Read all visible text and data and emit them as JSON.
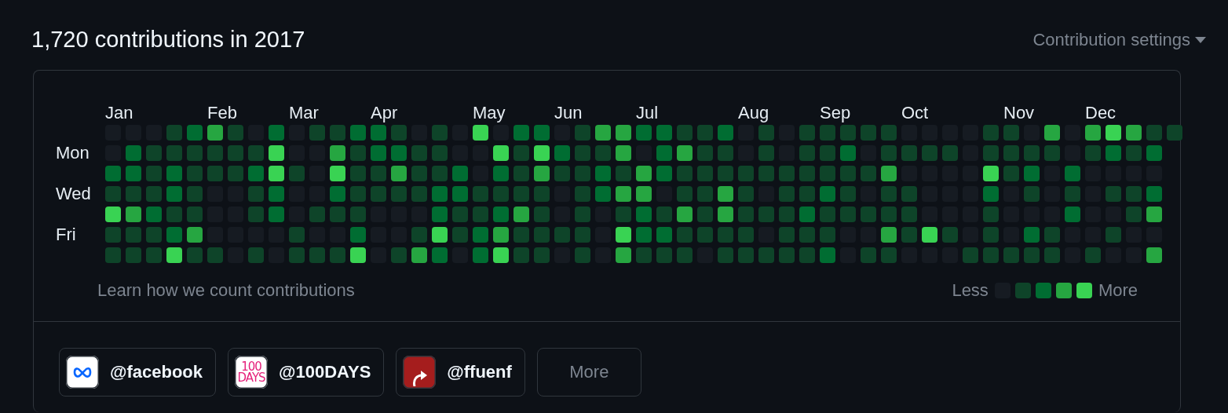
{
  "header": {
    "title": "1,720 contributions in 2017",
    "settings": "Contribution settings"
  },
  "graph": {
    "weekdays": [
      "Mon",
      "Wed",
      "Fri"
    ],
    "weeks": [
      {
        "month": "Jan",
        "days": [
          {
            "color": "#161b22"
          },
          {
            "color": "#161b22"
          },
          {
            "color": "#006d32"
          },
          {
            "color": "#0e4429"
          },
          {
            "color": "#39d353"
          },
          {
            "color": "#0e4429"
          },
          {
            "color": "#0e4429"
          }
        ]
      },
      {
        "days": [
          {
            "color": "#161b22"
          },
          {
            "color": "#006d32"
          },
          {
            "color": "#006d32"
          },
          {
            "color": "#0e4429"
          },
          {
            "color": "#26a641"
          },
          {
            "color": "#0e4429"
          },
          {
            "color": "#0e4429"
          }
        ]
      },
      {
        "days": [
          {
            "color": "#161b22"
          },
          {
            "color": "#0e4429"
          },
          {
            "color": "#0e4429"
          },
          {
            "color": "#0e4429"
          },
          {
            "color": "#006d32"
          },
          {
            "color": "#0e4429"
          },
          {
            "color": "#0e4429"
          }
        ]
      },
      {
        "days": [
          {
            "color": "#0e4429"
          },
          {
            "color": "#0e4429"
          },
          {
            "color": "#006d32"
          },
          {
            "color": "#006d32"
          },
          {
            "color": "#0e4429"
          },
          {
            "color": "#006d32"
          },
          {
            "color": "#39d353"
          }
        ]
      },
      {
        "days": [
          {
            "color": "#006d32"
          },
          {
            "color": "#0e4429"
          },
          {
            "color": "#0e4429"
          },
          {
            "color": "#0e4429"
          },
          {
            "color": "#0e4429"
          },
          {
            "color": "#26a641"
          },
          {
            "color": "#0e4429"
          }
        ]
      },
      {
        "month": "Feb",
        "days": [
          {
            "color": "#26a641"
          },
          {
            "color": "#0e4429"
          },
          {
            "color": "#0e4429"
          },
          {
            "color": "#161b22"
          },
          {
            "color": "#161b22"
          },
          {
            "color": "#161b22"
          },
          {
            "color": "#0e4429"
          }
        ]
      },
      {
        "days": [
          {
            "color": "#0e4429"
          },
          {
            "color": "#0e4429"
          },
          {
            "color": "#0e4429"
          },
          {
            "color": "#161b22"
          },
          {
            "color": "#161b22"
          },
          {
            "color": "#161b22"
          },
          {
            "color": "#161b22"
          }
        ]
      },
      {
        "days": [
          {
            "color": "#161b22"
          },
          {
            "color": "#0e4429"
          },
          {
            "color": "#006d32"
          },
          {
            "color": "#0e4429"
          },
          {
            "color": "#0e4429"
          },
          {
            "color": "#161b22"
          },
          {
            "color": "#0e4429"
          }
        ]
      },
      {
        "days": [
          {
            "color": "#006d32"
          },
          {
            "color": "#39d353"
          },
          {
            "color": "#39d353"
          },
          {
            "color": "#006d32"
          },
          {
            "color": "#006d32"
          },
          {
            "color": "#161b22"
          },
          {
            "color": "#161b22"
          }
        ]
      },
      {
        "month": "Mar",
        "days": [
          {
            "color": "#161b22"
          },
          {
            "color": "#161b22"
          },
          {
            "color": "#0e4429"
          },
          {
            "color": "#161b22"
          },
          {
            "color": "#161b22"
          },
          {
            "color": "#0e4429"
          },
          {
            "color": "#0e4429"
          }
        ]
      },
      {
        "days": [
          {
            "color": "#0e4429"
          },
          {
            "color": "#161b22"
          },
          {
            "color": "#161b22"
          },
          {
            "color": "#161b22"
          },
          {
            "color": "#0e4429"
          },
          {
            "color": "#161b22"
          },
          {
            "color": "#0e4429"
          }
        ]
      },
      {
        "days": [
          {
            "color": "#0e4429"
          },
          {
            "color": "#26a641"
          },
          {
            "color": "#39d353"
          },
          {
            "color": "#006d32"
          },
          {
            "color": "#0e4429"
          },
          {
            "color": "#161b22"
          },
          {
            "color": "#0e4429"
          }
        ]
      },
      {
        "days": [
          {
            "color": "#006d32"
          },
          {
            "color": "#0e4429"
          },
          {
            "color": "#0e4429"
          },
          {
            "color": "#0e4429"
          },
          {
            "color": "#0e4429"
          },
          {
            "color": "#006d32"
          },
          {
            "color": "#39d353"
          }
        ]
      },
      {
        "month": "Apr",
        "days": [
          {
            "color": "#006d32"
          },
          {
            "color": "#006d32"
          },
          {
            "color": "#0e4429"
          },
          {
            "color": "#0e4429"
          },
          {
            "color": "#161b22"
          },
          {
            "color": "#161b22"
          },
          {
            "color": "#161b22"
          }
        ]
      },
      {
        "days": [
          {
            "color": "#0e4429"
          },
          {
            "color": "#006d32"
          },
          {
            "color": "#26a641"
          },
          {
            "color": "#0e4429"
          },
          {
            "color": "#161b22"
          },
          {
            "color": "#161b22"
          },
          {
            "color": "#0e4429"
          }
        ]
      },
      {
        "days": [
          {
            "color": "#161b22"
          },
          {
            "color": "#0e4429"
          },
          {
            "color": "#0e4429"
          },
          {
            "color": "#0e4429"
          },
          {
            "color": "#161b22"
          },
          {
            "color": "#0e4429"
          },
          {
            "color": "#26a641"
          }
        ]
      },
      {
        "days": [
          {
            "color": "#0e4429"
          },
          {
            "color": "#0e4429"
          },
          {
            "color": "#0e4429"
          },
          {
            "color": "#006d32"
          },
          {
            "color": "#006d32"
          },
          {
            "color": "#39d353"
          },
          {
            "color": "#006d32"
          }
        ]
      },
      {
        "days": [
          {
            "color": "#161b22"
          },
          {
            "color": "#161b22"
          },
          {
            "color": "#006d32"
          },
          {
            "color": "#006d32"
          },
          {
            "color": "#0e4429"
          },
          {
            "color": "#0e4429"
          },
          {
            "color": "#161b22"
          }
        ]
      },
      {
        "month": "May",
        "days": [
          {
            "color": "#39d353"
          },
          {
            "color": "#161b22"
          },
          {
            "color": "#161b22"
          },
          {
            "color": "#0e4429"
          },
          {
            "color": "#0e4429"
          },
          {
            "color": "#006d32"
          },
          {
            "color": "#006d32"
          }
        ]
      },
      {
        "days": [
          {
            "color": "#161b22"
          },
          {
            "color": "#39d353"
          },
          {
            "color": "#006d32"
          },
          {
            "color": "#0e4429"
          },
          {
            "color": "#006d32"
          },
          {
            "color": "#26a641"
          },
          {
            "color": "#39d353"
          }
        ]
      },
      {
        "days": [
          {
            "color": "#006d32"
          },
          {
            "color": "#0e4429"
          },
          {
            "color": "#0e4429"
          },
          {
            "color": "#0e4429"
          },
          {
            "color": "#26a641"
          },
          {
            "color": "#0e4429"
          },
          {
            "color": "#0e4429"
          }
        ]
      },
      {
        "days": [
          {
            "color": "#006d32"
          },
          {
            "color": "#39d353"
          },
          {
            "color": "#26a641"
          },
          {
            "color": "#0e4429"
          },
          {
            "color": "#0e4429"
          },
          {
            "color": "#0e4429"
          },
          {
            "color": "#0e4429"
          }
        ]
      },
      {
        "month": "Jun",
        "days": [
          {
            "color": "#161b22"
          },
          {
            "color": "#006d32"
          },
          {
            "color": "#0e4429"
          },
          {
            "color": "#161b22"
          },
          {
            "color": "#161b22"
          },
          {
            "color": "#0e4429"
          },
          {
            "color": "#161b22"
          }
        ]
      },
      {
        "days": [
          {
            "color": "#0e4429"
          },
          {
            "color": "#0e4429"
          },
          {
            "color": "#0e4429"
          },
          {
            "color": "#0e4429"
          },
          {
            "color": "#0e4429"
          },
          {
            "color": "#0e4429"
          },
          {
            "color": "#0e4429"
          }
        ]
      },
      {
        "days": [
          {
            "color": "#26a641"
          },
          {
            "color": "#0e4429"
          },
          {
            "color": "#006d32"
          },
          {
            "color": "#006d32"
          },
          {
            "color": "#161b22"
          },
          {
            "color": "#161b22"
          },
          {
            "color": "#161b22"
          }
        ]
      },
      {
        "days": [
          {
            "color": "#26a641"
          },
          {
            "color": "#26a641"
          },
          {
            "color": "#0e4429"
          },
          {
            "color": "#26a641"
          },
          {
            "color": "#0e4429"
          },
          {
            "color": "#39d353"
          },
          {
            "color": "#26a641"
          }
        ]
      },
      {
        "month": "Jul",
        "days": [
          {
            "color": "#006d32"
          },
          {
            "color": "#161b22"
          },
          {
            "color": "#26a641"
          },
          {
            "color": "#26a641"
          },
          {
            "color": "#006d32"
          },
          {
            "color": "#006d32"
          },
          {
            "color": "#0e4429"
          }
        ]
      },
      {
        "days": [
          {
            "color": "#006d32"
          },
          {
            "color": "#006d32"
          },
          {
            "color": "#006d32"
          },
          {
            "color": "#161b22"
          },
          {
            "color": "#0e4429"
          },
          {
            "color": "#006d32"
          },
          {
            "color": "#0e4429"
          }
        ]
      },
      {
        "days": [
          {
            "color": "#0e4429"
          },
          {
            "color": "#26a641"
          },
          {
            "color": "#0e4429"
          },
          {
            "color": "#0e4429"
          },
          {
            "color": "#26a641"
          },
          {
            "color": "#0e4429"
          },
          {
            "color": "#0e4429"
          }
        ]
      },
      {
        "days": [
          {
            "color": "#0e4429"
          },
          {
            "color": "#0e4429"
          },
          {
            "color": "#0e4429"
          },
          {
            "color": "#0e4429"
          },
          {
            "color": "#0e4429"
          },
          {
            "color": "#0e4429"
          },
          {
            "color": "#161b22"
          }
        ]
      },
      {
        "days": [
          {
            "color": "#006d32"
          },
          {
            "color": "#0e4429"
          },
          {
            "color": "#0e4429"
          },
          {
            "color": "#26a641"
          },
          {
            "color": "#26a641"
          },
          {
            "color": "#0e4429"
          },
          {
            "color": "#0e4429"
          }
        ]
      },
      {
        "month": "Aug",
        "days": [
          {
            "color": "#161b22"
          },
          {
            "color": "#161b22"
          },
          {
            "color": "#0e4429"
          },
          {
            "color": "#0e4429"
          },
          {
            "color": "#0e4429"
          },
          {
            "color": "#0e4429"
          },
          {
            "color": "#0e4429"
          }
        ]
      },
      {
        "days": [
          {
            "color": "#0e4429"
          },
          {
            "color": "#0e4429"
          },
          {
            "color": "#0e4429"
          },
          {
            "color": "#161b22"
          },
          {
            "color": "#0e4429"
          },
          {
            "color": "#161b22"
          },
          {
            "color": "#0e4429"
          }
        ]
      },
      {
        "days": [
          {
            "color": "#161b22"
          },
          {
            "color": "#161b22"
          },
          {
            "color": "#0e4429"
          },
          {
            "color": "#0e4429"
          },
          {
            "color": "#0e4429"
          },
          {
            "color": "#0e4429"
          },
          {
            "color": "#0e4429"
          }
        ]
      },
      {
        "days": [
          {
            "color": "#0e4429"
          },
          {
            "color": "#0e4429"
          },
          {
            "color": "#0e4429"
          },
          {
            "color": "#0e4429"
          },
          {
            "color": "#006d32"
          },
          {
            "color": "#0e4429"
          },
          {
            "color": "#0e4429"
          }
        ]
      },
      {
        "month": "Sep",
        "days": [
          {
            "color": "#0e4429"
          },
          {
            "color": "#0e4429"
          },
          {
            "color": "#0e4429"
          },
          {
            "color": "#006d32"
          },
          {
            "color": "#0e4429"
          },
          {
            "color": "#0e4429"
          },
          {
            "color": "#006d32"
          }
        ]
      },
      {
        "days": [
          {
            "color": "#0e4429"
          },
          {
            "color": "#006d32"
          },
          {
            "color": "#0e4429"
          },
          {
            "color": "#0e4429"
          },
          {
            "color": "#0e4429"
          },
          {
            "color": "#161b22"
          },
          {
            "color": "#161b22"
          }
        ]
      },
      {
        "days": [
          {
            "color": "#0e4429"
          },
          {
            "color": "#161b22"
          },
          {
            "color": "#0e4429"
          },
          {
            "color": "#161b22"
          },
          {
            "color": "#0e4429"
          },
          {
            "color": "#161b22"
          },
          {
            "color": "#0e4429"
          }
        ]
      },
      {
        "days": [
          {
            "color": "#0e4429"
          },
          {
            "color": "#0e4429"
          },
          {
            "color": "#26a641"
          },
          {
            "color": "#0e4429"
          },
          {
            "color": "#0e4429"
          },
          {
            "color": "#26a641"
          },
          {
            "color": "#0e4429"
          }
        ]
      },
      {
        "month": "Oct",
        "days": [
          {
            "color": "#161b22"
          },
          {
            "color": "#0e4429"
          },
          {
            "color": "#161b22"
          },
          {
            "color": "#0e4429"
          },
          {
            "color": "#0e4429"
          },
          {
            "color": "#0e4429"
          },
          {
            "color": "#161b22"
          }
        ]
      },
      {
        "days": [
          {
            "color": "#161b22"
          },
          {
            "color": "#0e4429"
          },
          {
            "color": "#161b22"
          },
          {
            "color": "#161b22"
          },
          {
            "color": "#161b22"
          },
          {
            "color": "#39d353"
          },
          {
            "color": "#161b22"
          }
        ]
      },
      {
        "days": [
          {
            "color": "#161b22"
          },
          {
            "color": "#0e4429"
          },
          {
            "color": "#161b22"
          },
          {
            "color": "#161b22"
          },
          {
            "color": "#161b22"
          },
          {
            "color": "#0e4429"
          },
          {
            "color": "#161b22"
          }
        ]
      },
      {
        "days": [
          {
            "color": "#161b22"
          },
          {
            "color": "#161b22"
          },
          {
            "color": "#161b22"
          },
          {
            "color": "#161b22"
          },
          {
            "color": "#161b22"
          },
          {
            "color": "#161b22"
          },
          {
            "color": "#0e4429"
          }
        ]
      },
      {
        "days": [
          {
            "color": "#0e4429"
          },
          {
            "color": "#0e4429"
          },
          {
            "color": "#39d353"
          },
          {
            "color": "#006d32"
          },
          {
            "color": "#0e4429"
          },
          {
            "color": "#0e4429"
          },
          {
            "color": "#0e4429"
          }
        ]
      },
      {
        "month": "Nov",
        "days": [
          {
            "color": "#0e4429"
          },
          {
            "color": "#0e4429"
          },
          {
            "color": "#0e4429"
          },
          {
            "color": "#161b22"
          },
          {
            "color": "#161b22"
          },
          {
            "color": "#161b22"
          },
          {
            "color": "#0e4429"
          }
        ]
      },
      {
        "days": [
          {
            "color": "#161b22"
          },
          {
            "color": "#0e4429"
          },
          {
            "color": "#006d32"
          },
          {
            "color": "#0e4429"
          },
          {
            "color": "#161b22"
          },
          {
            "color": "#006d32"
          },
          {
            "color": "#0e4429"
          }
        ]
      },
      {
        "days": [
          {
            "color": "#26a641"
          },
          {
            "color": "#0e4429"
          },
          {
            "color": "#161b22"
          },
          {
            "color": "#161b22"
          },
          {
            "color": "#161b22"
          },
          {
            "color": "#0e4429"
          },
          {
            "color": "#0e4429"
          }
        ]
      },
      {
        "days": [
          {
            "color": "#161b22"
          },
          {
            "color": "#161b22"
          },
          {
            "color": "#006d32"
          },
          {
            "color": "#0e4429"
          },
          {
            "color": "#006d32"
          },
          {
            "color": "#161b22"
          },
          {
            "color": "#161b22"
          }
        ]
      },
      {
        "month": "Dec",
        "days": [
          {
            "color": "#26a641"
          },
          {
            "color": "#0e4429"
          },
          {
            "color": "#161b22"
          },
          {
            "color": "#161b22"
          },
          {
            "color": "#161b22"
          },
          {
            "color": "#161b22"
          },
          {
            "color": "#0e4429"
          }
        ]
      },
      {
        "days": [
          {
            "color": "#39d353"
          },
          {
            "color": "#006d32"
          },
          {
            "color": "#161b22"
          },
          {
            "color": "#0e4429"
          },
          {
            "color": "#161b22"
          },
          {
            "color": "#0e4429"
          },
          {
            "color": "#161b22"
          }
        ]
      },
      {
        "days": [
          {
            "color": "#26a641"
          },
          {
            "color": "#0e4429"
          },
          {
            "color": "#161b22"
          },
          {
            "color": "#0e4429"
          },
          {
            "color": "#0e4429"
          },
          {
            "color": "#161b22"
          },
          {
            "color": "#161b22"
          }
        ]
      },
      {
        "days": [
          {
            "color": "#0e4429"
          },
          {
            "color": "#006d32"
          },
          {
            "color": "#161b22"
          },
          {
            "color": "#006d32"
          },
          {
            "color": "#26a641"
          },
          {
            "color": "#161b22"
          },
          {
            "color": "#26a641"
          }
        ]
      },
      {
        "days": [
          {
            "color": "#0e4429"
          }
        ]
      }
    ],
    "help_link": "Learn how we count contributions",
    "legend": {
      "less": "Less",
      "more": "More"
    }
  },
  "organizations": [
    {
      "name": "@facebook",
      "kind": "meta",
      "color": "#ffffff"
    },
    {
      "name": "@100DAYS",
      "kind": "text",
      "color": "#ffffff",
      "logo_text": [
        "100",
        "DAYS"
      ]
    },
    {
      "name": "@ffuenf",
      "kind": "arrow",
      "color": "#a51d1d"
    }
  ],
  "more_button": "More"
}
